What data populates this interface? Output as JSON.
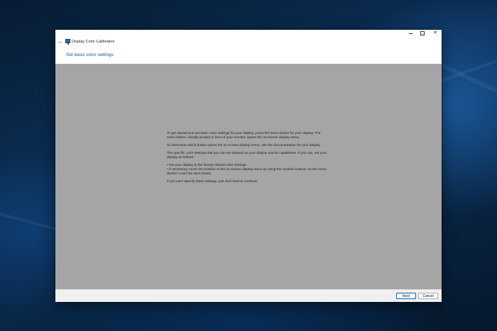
{
  "window": {
    "title": "Display Color Calibration",
    "close_glyph": "✕",
    "back_glyph": "←"
  },
  "page": {
    "heading": "Set basic color settings",
    "paragraphs": [
      "To get started and set basic color settings for your display, press the menu button for your display. The menu button, usually located in front of your monitor, opens the on-screen display menu.",
      "To determine which button opens the on-screen display menu, see the documentation for your display.",
      "The specific color settings that you can set depend on your display and its capabilities. If you can, set your display as follows:"
    ],
    "bullets": [
      "• Set your display to the factory default color settings.",
      "• If necessary, move the position of the on-screen display menu by using the monitor buttons, so the menu doesn't cover the Next button."
    ],
    "closing": "If you can't specify these settings, just click Next to continue."
  },
  "footer": {
    "next_label": "Next",
    "cancel_label": "Cancel"
  },
  "colors": {
    "heading": "#1f4fa8",
    "content_bg": "#a5a5a5",
    "accent": "#0067c0"
  },
  "icons": {
    "back": "back-arrow-icon",
    "app": "display-monitor-icon",
    "minimize": "minimize-icon",
    "maximize": "maximize-icon",
    "close": "close-icon"
  }
}
